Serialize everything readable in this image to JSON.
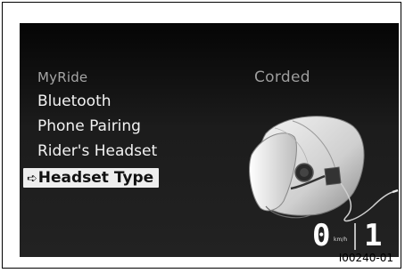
{
  "menu": {
    "title": "MyRide",
    "items": [
      {
        "label": "Bluetooth"
      },
      {
        "label": "Phone Pairing"
      },
      {
        "label": "Rider's Headset"
      },
      {
        "label": "Headset Type",
        "selected": true
      }
    ],
    "selected_arrow": "➪"
  },
  "setting": {
    "value": "Corded"
  },
  "status": {
    "speed": "0",
    "speed_unit": "km/h",
    "gear": "1"
  },
  "figure": {
    "reference_code": "I00240-01"
  },
  "colors": {
    "screen_background": "#1a1a1a",
    "selected_highlight": "#eeeeee",
    "text_primary": "#f2f2f2",
    "text_dim": "#a5a5a5"
  },
  "icons": [
    "helmet-with-corded-headset"
  ]
}
